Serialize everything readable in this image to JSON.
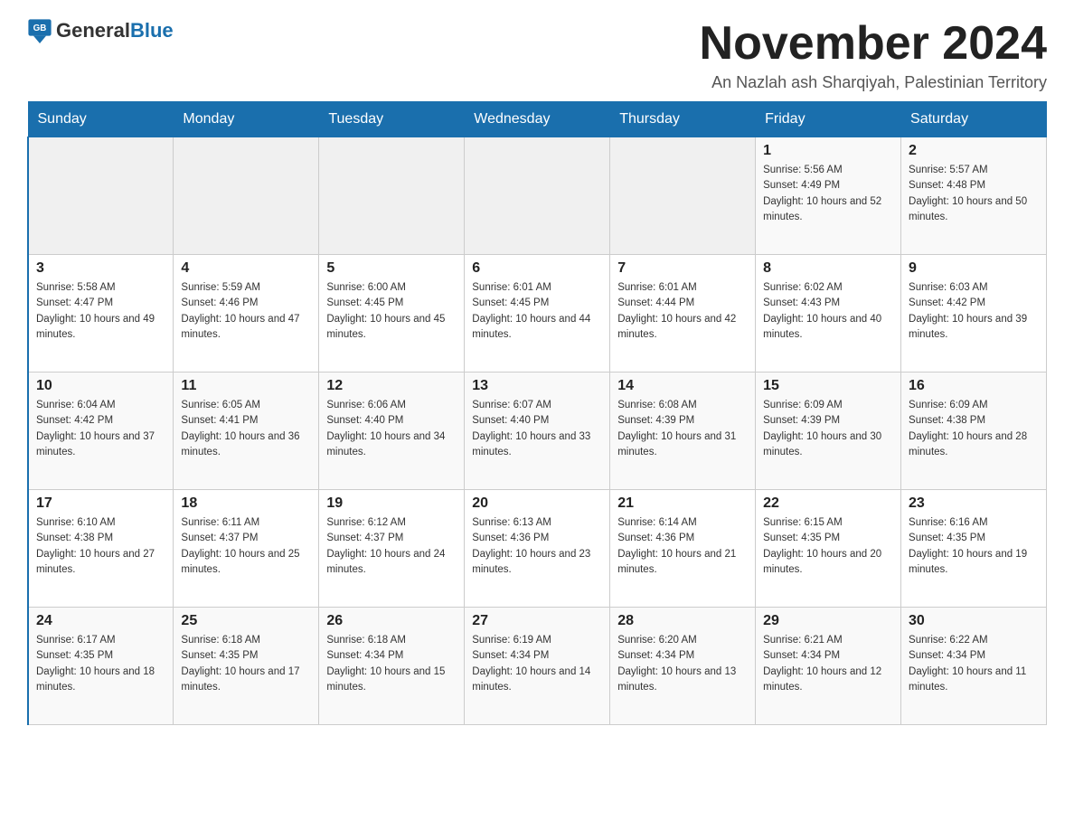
{
  "logo": {
    "text_general": "General",
    "text_blue": "Blue"
  },
  "title": "November 2024",
  "subtitle": "An Nazlah ash Sharqiyah, Palestinian Territory",
  "days_of_week": [
    "Sunday",
    "Monday",
    "Tuesday",
    "Wednesday",
    "Thursday",
    "Friday",
    "Saturday"
  ],
  "weeks": [
    [
      {
        "day": "",
        "info": ""
      },
      {
        "day": "",
        "info": ""
      },
      {
        "day": "",
        "info": ""
      },
      {
        "day": "",
        "info": ""
      },
      {
        "day": "",
        "info": ""
      },
      {
        "day": "1",
        "info": "Sunrise: 5:56 AM\nSunset: 4:49 PM\nDaylight: 10 hours and 52 minutes."
      },
      {
        "day": "2",
        "info": "Sunrise: 5:57 AM\nSunset: 4:48 PM\nDaylight: 10 hours and 50 minutes."
      }
    ],
    [
      {
        "day": "3",
        "info": "Sunrise: 5:58 AM\nSunset: 4:47 PM\nDaylight: 10 hours and 49 minutes."
      },
      {
        "day": "4",
        "info": "Sunrise: 5:59 AM\nSunset: 4:46 PM\nDaylight: 10 hours and 47 minutes."
      },
      {
        "day": "5",
        "info": "Sunrise: 6:00 AM\nSunset: 4:45 PM\nDaylight: 10 hours and 45 minutes."
      },
      {
        "day": "6",
        "info": "Sunrise: 6:01 AM\nSunset: 4:45 PM\nDaylight: 10 hours and 44 minutes."
      },
      {
        "day": "7",
        "info": "Sunrise: 6:01 AM\nSunset: 4:44 PM\nDaylight: 10 hours and 42 minutes."
      },
      {
        "day": "8",
        "info": "Sunrise: 6:02 AM\nSunset: 4:43 PM\nDaylight: 10 hours and 40 minutes."
      },
      {
        "day": "9",
        "info": "Sunrise: 6:03 AM\nSunset: 4:42 PM\nDaylight: 10 hours and 39 minutes."
      }
    ],
    [
      {
        "day": "10",
        "info": "Sunrise: 6:04 AM\nSunset: 4:42 PM\nDaylight: 10 hours and 37 minutes."
      },
      {
        "day": "11",
        "info": "Sunrise: 6:05 AM\nSunset: 4:41 PM\nDaylight: 10 hours and 36 minutes."
      },
      {
        "day": "12",
        "info": "Sunrise: 6:06 AM\nSunset: 4:40 PM\nDaylight: 10 hours and 34 minutes."
      },
      {
        "day": "13",
        "info": "Sunrise: 6:07 AM\nSunset: 4:40 PM\nDaylight: 10 hours and 33 minutes."
      },
      {
        "day": "14",
        "info": "Sunrise: 6:08 AM\nSunset: 4:39 PM\nDaylight: 10 hours and 31 minutes."
      },
      {
        "day": "15",
        "info": "Sunrise: 6:09 AM\nSunset: 4:39 PM\nDaylight: 10 hours and 30 minutes."
      },
      {
        "day": "16",
        "info": "Sunrise: 6:09 AM\nSunset: 4:38 PM\nDaylight: 10 hours and 28 minutes."
      }
    ],
    [
      {
        "day": "17",
        "info": "Sunrise: 6:10 AM\nSunset: 4:38 PM\nDaylight: 10 hours and 27 minutes."
      },
      {
        "day": "18",
        "info": "Sunrise: 6:11 AM\nSunset: 4:37 PM\nDaylight: 10 hours and 25 minutes."
      },
      {
        "day": "19",
        "info": "Sunrise: 6:12 AM\nSunset: 4:37 PM\nDaylight: 10 hours and 24 minutes."
      },
      {
        "day": "20",
        "info": "Sunrise: 6:13 AM\nSunset: 4:36 PM\nDaylight: 10 hours and 23 minutes."
      },
      {
        "day": "21",
        "info": "Sunrise: 6:14 AM\nSunset: 4:36 PM\nDaylight: 10 hours and 21 minutes."
      },
      {
        "day": "22",
        "info": "Sunrise: 6:15 AM\nSunset: 4:35 PM\nDaylight: 10 hours and 20 minutes."
      },
      {
        "day": "23",
        "info": "Sunrise: 6:16 AM\nSunset: 4:35 PM\nDaylight: 10 hours and 19 minutes."
      }
    ],
    [
      {
        "day": "24",
        "info": "Sunrise: 6:17 AM\nSunset: 4:35 PM\nDaylight: 10 hours and 18 minutes."
      },
      {
        "day": "25",
        "info": "Sunrise: 6:18 AM\nSunset: 4:35 PM\nDaylight: 10 hours and 17 minutes."
      },
      {
        "day": "26",
        "info": "Sunrise: 6:18 AM\nSunset: 4:34 PM\nDaylight: 10 hours and 15 minutes."
      },
      {
        "day": "27",
        "info": "Sunrise: 6:19 AM\nSunset: 4:34 PM\nDaylight: 10 hours and 14 minutes."
      },
      {
        "day": "28",
        "info": "Sunrise: 6:20 AM\nSunset: 4:34 PM\nDaylight: 10 hours and 13 minutes."
      },
      {
        "day": "29",
        "info": "Sunrise: 6:21 AM\nSunset: 4:34 PM\nDaylight: 10 hours and 12 minutes."
      },
      {
        "day": "30",
        "info": "Sunrise: 6:22 AM\nSunset: 4:34 PM\nDaylight: 10 hours and 11 minutes."
      }
    ]
  ]
}
